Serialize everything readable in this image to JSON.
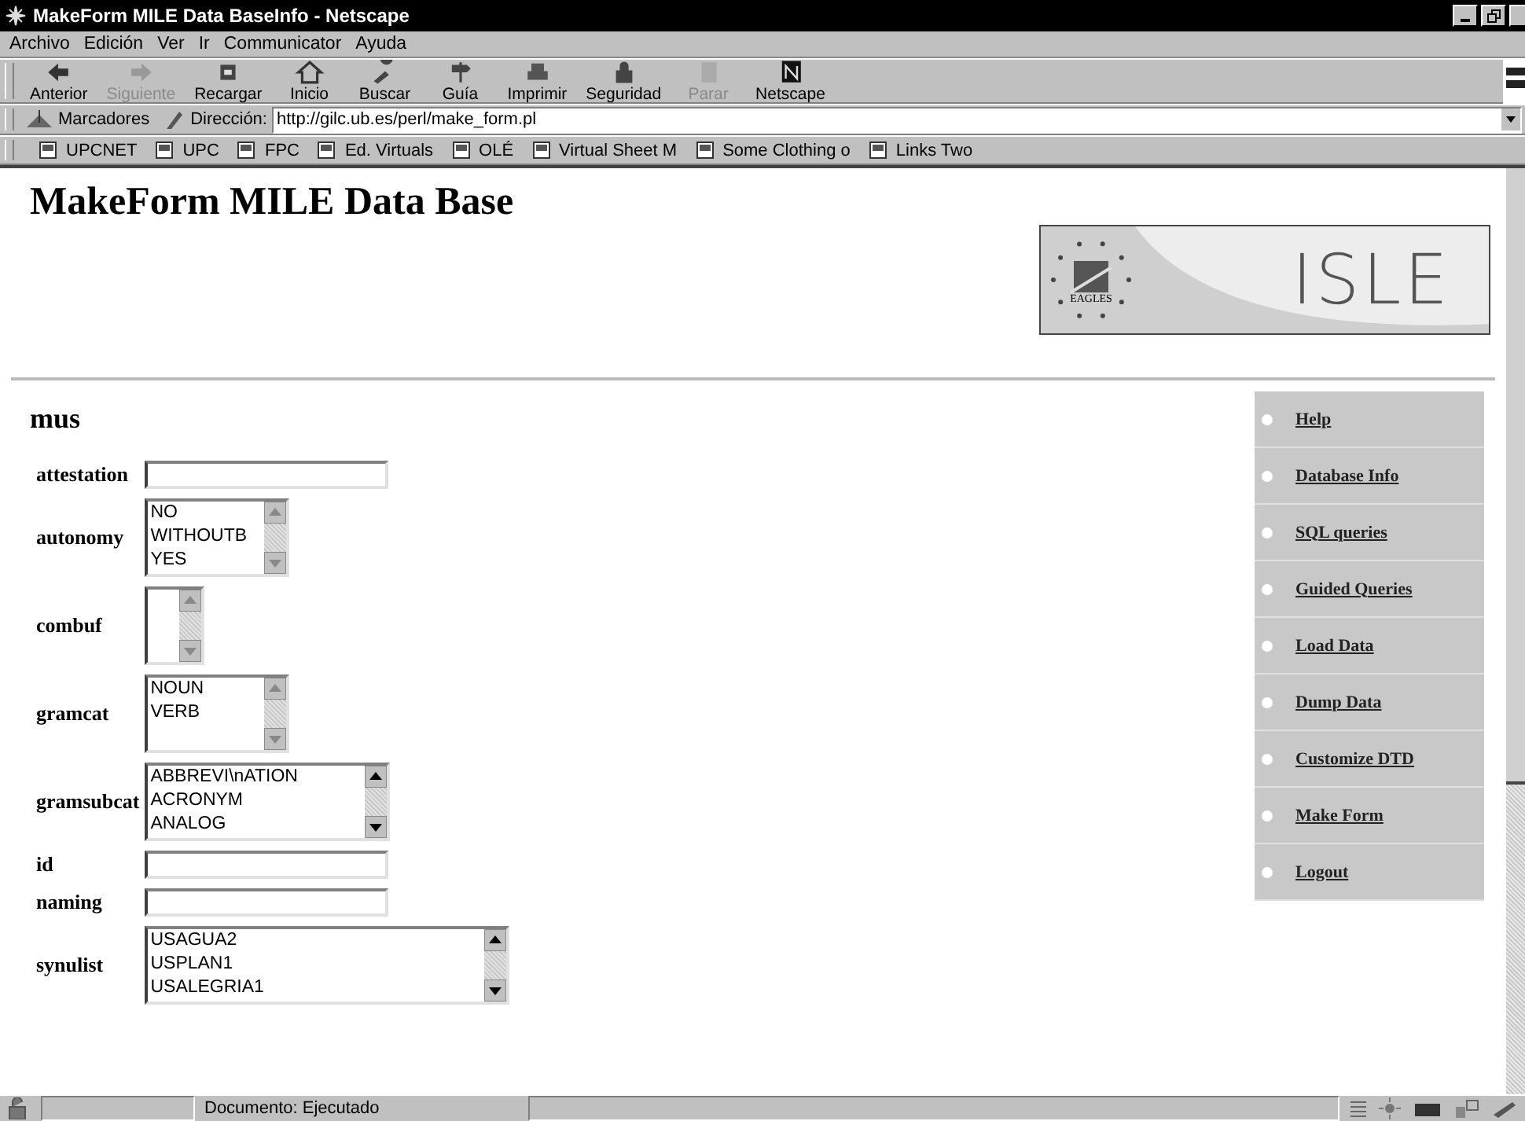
{
  "window": {
    "title": "MakeForm MILE Data BaseInfo - Netscape"
  },
  "menu": [
    "Archivo",
    "Edición",
    "Ver",
    "Ir",
    "Communicator",
    "Ayuda"
  ],
  "toolbar": [
    {
      "label": "Anterior",
      "disabled": false
    },
    {
      "label": "Siguiente",
      "disabled": true
    },
    {
      "label": "Recargar",
      "disabled": false
    },
    {
      "label": "Inicio",
      "disabled": false
    },
    {
      "label": "Buscar",
      "disabled": false
    },
    {
      "label": "Guía",
      "disabled": false
    },
    {
      "label": "Imprimir",
      "disabled": false
    },
    {
      "label": "Seguridad",
      "disabled": false
    },
    {
      "label": "Parar",
      "disabled": true
    },
    {
      "label": "Netscape",
      "disabled": false
    }
  ],
  "location": {
    "bookmarks": "Marcadores",
    "label": "Dirección:",
    "value": "http://gilc.ub.es/perl/make_form.pl"
  },
  "personal_bar": [
    "UPCNET",
    "UPC",
    "FPC",
    "Ed. Virtuals",
    "OLÉ",
    "Virtual Sheet M",
    "Some Clothing o",
    "Links Two"
  ],
  "page": {
    "heading": "MakeForm MILE Data Base",
    "banner": {
      "logo": "ISLE",
      "emblem": "EAGLES"
    },
    "subheading": "mus",
    "fields": [
      {
        "label": "attestation",
        "kind": "text"
      },
      {
        "label": "autonomy",
        "kind": "list",
        "options": [
          "NO",
          "WITHOUTB",
          "YES"
        ]
      },
      {
        "label": "combuf",
        "kind": "list"
      },
      {
        "label": "gramcat",
        "kind": "list",
        "options": [
          "NOUN",
          "VERB"
        ]
      },
      {
        "label": "gramsubcat",
        "kind": "list",
        "options": [
          "ABBREVI\\nATION",
          "ACRONYM",
          "ANALOG"
        ]
      },
      {
        "label": "id",
        "kind": "text"
      },
      {
        "label": "naming",
        "kind": "text"
      },
      {
        "label": "synulist",
        "kind": "list",
        "options": [
          "USAGUA2",
          "USPLAN1",
          "USALEGRIA1"
        ]
      }
    ],
    "nav": [
      "Help",
      "Database Info",
      "SQL queries",
      "Guided Queries",
      "Load Data",
      "Dump Data",
      "Customize DTD",
      "Make Form",
      "Logout"
    ]
  },
  "status_bar": {
    "text": "Documento: Ejecutado"
  }
}
